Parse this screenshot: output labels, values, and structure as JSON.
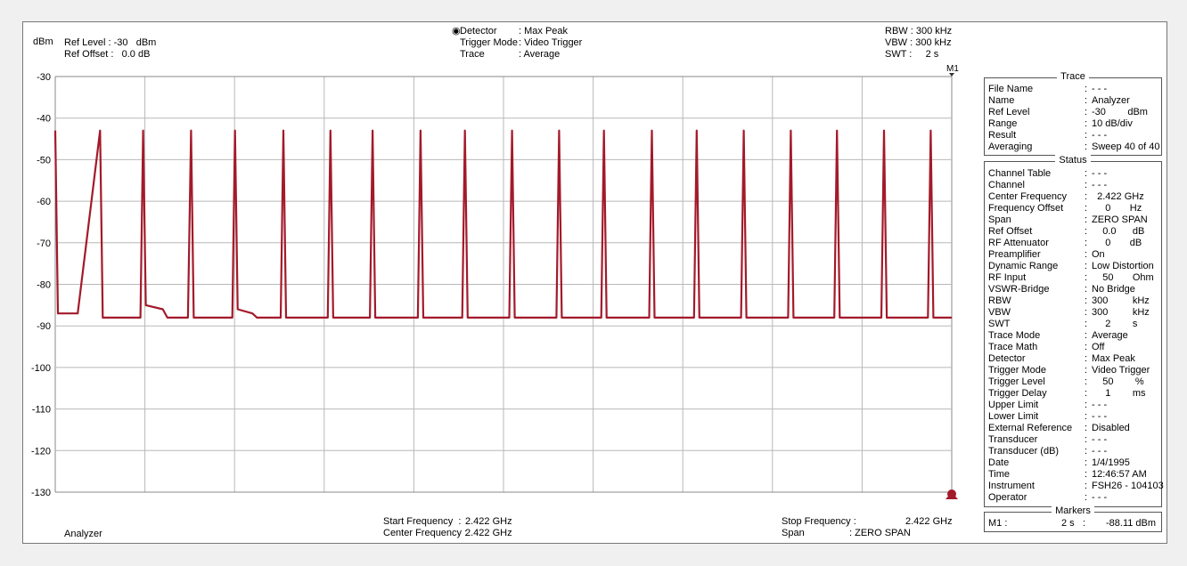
{
  "header": {
    "unit": "dBm",
    "ref_level_label": "Ref Level : -30   dBm",
    "ref_offset_label": "Ref Offset :   0.0 dB",
    "detector_label": "Detector",
    "detector_sep": ": Max Peak",
    "trigger_mode_label": "Trigger Mode",
    "trigger_mode_sep": ": Video Trigger",
    "trace_label": "Trace",
    "trace_sep": ": Average",
    "rbw": "RBW : 300 kHz",
    "vbw": "VBW : 300 kHz",
    "swt": "SWT :     2 s",
    "marker_flag": "M1"
  },
  "footer": {
    "mode": "Analyzer",
    "start_freq_label": "Start Frequency  :",
    "start_freq_value": "2.422 GHz",
    "center_freq_label": "Center Frequency :",
    "center_freq_value": "2.422 GHz",
    "stop_freq_label": "Stop Frequency :",
    "stop_freq_value": "2.422 GHz",
    "span_label": "Span",
    "span_value": ": ZERO SPAN"
  },
  "trace_panel": {
    "title": "Trace",
    "rows": [
      {
        "label": "File Name",
        "value": "- - -"
      },
      {
        "label": "Name",
        "value": "Analyzer"
      },
      {
        "label": "Ref Level",
        "value": "-30        dBm"
      },
      {
        "label": "Range",
        "value": "10 dB/div"
      },
      {
        "label": "Result",
        "value": "- - -"
      },
      {
        "label": "Averaging",
        "value": "Sweep 40 of 40"
      }
    ]
  },
  "status_panel": {
    "title": "Status",
    "rows": [
      {
        "label": "Channel Table",
        "value": "- - -"
      },
      {
        "label": "Channel",
        "value": "- - -"
      },
      {
        "label": "Center Frequency",
        "value": "  2.422 GHz"
      },
      {
        "label": "Frequency Offset",
        "value": "     0       Hz"
      },
      {
        "label": "Span",
        "value": "ZERO SPAN"
      },
      {
        "label": "Ref Offset",
        "value": "    0.0      dB"
      },
      {
        "label": "RF Attenuator",
        "value": "     0       dB"
      },
      {
        "label": "Preamplifier",
        "value": "On"
      },
      {
        "label": "Dynamic Range",
        "value": "Low Distortion"
      },
      {
        "label": "RF Input",
        "value": "    50       Ohm"
      },
      {
        "label": "VSWR-Bridge",
        "value": "No Bridge"
      },
      {
        "label": "RBW",
        "value": "300         kHz"
      },
      {
        "label": "VBW",
        "value": "300         kHz"
      },
      {
        "label": "SWT",
        "value": "     2        s"
      },
      {
        "label": "Trace Mode",
        "value": "Average"
      },
      {
        "label": "Trace Math",
        "value": "Off"
      },
      {
        "label": "Detector",
        "value": "Max Peak"
      },
      {
        "label": "Trigger Mode",
        "value": "Video Trigger"
      },
      {
        "label": "Trigger Level",
        "value": "    50        %"
      },
      {
        "label": "Trigger Delay",
        "value": "     1        ms"
      },
      {
        "label": "Upper Limit",
        "value": "- - -"
      },
      {
        "label": "Lower Limit",
        "value": "- - -"
      },
      {
        "label": "External Reference",
        "value": "Disabled"
      },
      {
        "label": "Transducer",
        "value": "- - -"
      },
      {
        "label": "Transducer (dB)",
        "value": "- - -"
      },
      {
        "label": "Date",
        "value": "1/4/1995"
      },
      {
        "label": "Time",
        "value": "12:46:57 AM"
      },
      {
        "label": "Instrument",
        "value": "FSH26 - 104103"
      },
      {
        "label": "Operator",
        "value": "- - -"
      }
    ]
  },
  "markers_panel": {
    "title": "Markers",
    "name": "M1 :",
    "x": "2 s",
    "sep": ":",
    "y": "-88.11 dBm"
  },
  "colors": {
    "trace": "#a31a2a",
    "grid": "#b8b8b8",
    "frame": "#777777"
  },
  "chart_data": {
    "type": "line",
    "title": "",
    "xlabel": "",
    "ylabel": "dBm",
    "xlim": [
      0,
      2
    ],
    "ylim": [
      -130,
      -30
    ],
    "yticks": [
      -30,
      -40,
      -50,
      -60,
      -70,
      -80,
      -90,
      -100,
      -110,
      -120,
      -130
    ],
    "grid": true,
    "baseline": -88,
    "peak_level": -43,
    "burst_times_s": [
      0.0,
      0.098,
      0.196,
      0.303,
      0.401,
      0.509,
      0.614,
      0.708,
      0.815,
      0.914,
      1.019,
      1.124,
      1.224,
      1.331,
      1.431,
      1.536,
      1.641,
      1.744,
      1.849,
      1.953
    ],
    "series": [
      {
        "values_comment": "",
        "points": [
          [
            0.0,
            -43
          ],
          [
            0.006,
            -87
          ],
          [
            0.05,
            -87
          ],
          [
            0.1,
            -43
          ],
          [
            0.106,
            -88
          ],
          [
            0.19,
            -88
          ],
          [
            0.196,
            -43
          ],
          [
            0.202,
            -85
          ],
          [
            0.24,
            -86
          ],
          [
            0.25,
            -88
          ],
          [
            0.296,
            -88
          ],
          [
            0.303,
            -43
          ],
          [
            0.309,
            -88
          ],
          [
            0.395,
            -88
          ],
          [
            0.401,
            -43
          ],
          [
            0.407,
            -86
          ],
          [
            0.44,
            -87
          ],
          [
            0.45,
            -88
          ],
          [
            0.503,
            -88
          ],
          [
            0.509,
            -43
          ],
          [
            0.515,
            -88
          ],
          [
            0.608,
            -88
          ],
          [
            0.614,
            -43
          ],
          [
            0.62,
            -88
          ],
          [
            0.702,
            -88
          ],
          [
            0.708,
            -43
          ],
          [
            0.714,
            -88
          ],
          [
            0.809,
            -88
          ],
          [
            0.815,
            -43
          ],
          [
            0.821,
            -88
          ],
          [
            0.908,
            -88
          ],
          [
            0.914,
            -43
          ],
          [
            0.92,
            -88
          ],
          [
            1.013,
            -88
          ],
          [
            1.019,
            -43
          ],
          [
            1.025,
            -88
          ],
          [
            1.118,
            -88
          ],
          [
            1.124,
            -43
          ],
          [
            1.13,
            -88
          ],
          [
            1.218,
            -88
          ],
          [
            1.224,
            -43
          ],
          [
            1.23,
            -88
          ],
          [
            1.325,
            -88
          ],
          [
            1.331,
            -43
          ],
          [
            1.337,
            -88
          ],
          [
            1.425,
            -88
          ],
          [
            1.431,
            -43
          ],
          [
            1.437,
            -88
          ],
          [
            1.53,
            -88
          ],
          [
            1.536,
            -43
          ],
          [
            1.542,
            -88
          ],
          [
            1.635,
            -88
          ],
          [
            1.641,
            -43
          ],
          [
            1.647,
            -88
          ],
          [
            1.738,
            -88
          ],
          [
            1.744,
            -43
          ],
          [
            1.75,
            -88
          ],
          [
            1.843,
            -88
          ],
          [
            1.849,
            -43
          ],
          [
            1.855,
            -88
          ],
          [
            1.947,
            -88
          ],
          [
            1.953,
            -43
          ],
          [
            1.959,
            -88
          ],
          [
            2.0,
            -88
          ]
        ]
      }
    ],
    "marker": {
      "name": "M1",
      "x": 2,
      "y": -88.11
    }
  }
}
